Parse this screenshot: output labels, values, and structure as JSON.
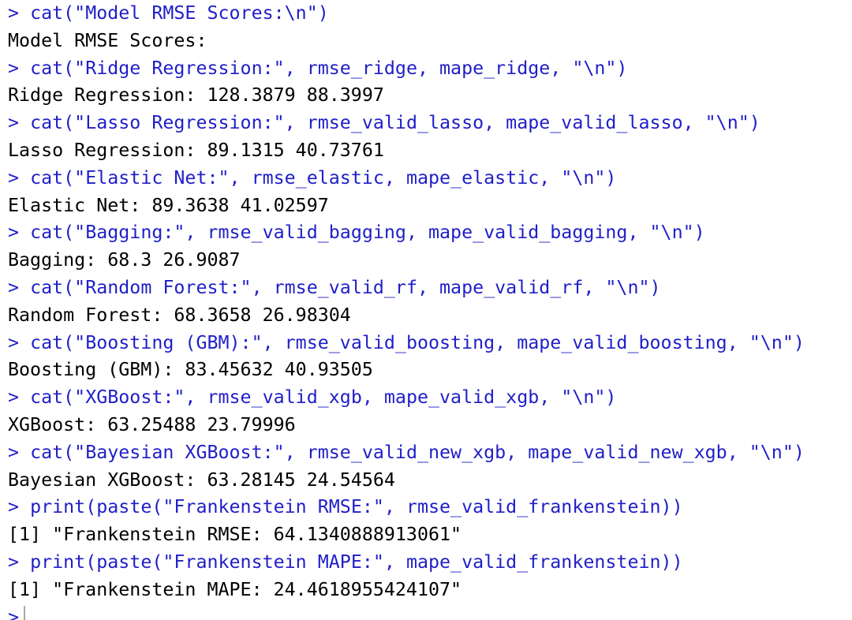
{
  "console": {
    "prompt_symbol": ">",
    "lines": [
      {
        "kind": "cmd",
        "text": "cat(\"Model RMSE Scores:\\n\")"
      },
      {
        "kind": "out",
        "text": "Model RMSE Scores:"
      },
      {
        "kind": "cmd",
        "text": "cat(\"Ridge Regression:\", rmse_ridge, mape_ridge, \"\\n\")"
      },
      {
        "kind": "out",
        "text": "Ridge Regression: 128.3879 88.3997"
      },
      {
        "kind": "cmd",
        "text": "cat(\"Lasso Regression:\", rmse_valid_lasso, mape_valid_lasso, \"\\n\")"
      },
      {
        "kind": "out",
        "text": "Lasso Regression: 89.1315 40.73761"
      },
      {
        "kind": "cmd",
        "text": "cat(\"Elastic Net:\", rmse_elastic, mape_elastic, \"\\n\")"
      },
      {
        "kind": "out",
        "text": "Elastic Net: 89.3638 41.02597"
      },
      {
        "kind": "cmd",
        "text": "cat(\"Bagging:\", rmse_valid_bagging, mape_valid_bagging, \"\\n\")"
      },
      {
        "kind": "out",
        "text": "Bagging: 68.3 26.9087"
      },
      {
        "kind": "cmd",
        "text": "cat(\"Random Forest:\", rmse_valid_rf, mape_valid_rf, \"\\n\")"
      },
      {
        "kind": "out",
        "text": "Random Forest: 68.3658 26.98304"
      },
      {
        "kind": "cmd",
        "text": "cat(\"Boosting (GBM):\", rmse_valid_boosting, mape_valid_boosting, \"\\n\")"
      },
      {
        "kind": "out",
        "text": "Boosting (GBM): 83.45632 40.93505"
      },
      {
        "kind": "cmd",
        "text": "cat(\"XGBoost:\", rmse_valid_xgb, mape_valid_xgb, \"\\n\")"
      },
      {
        "kind": "out",
        "text": "XGBoost: 63.25488 23.79996"
      },
      {
        "kind": "cmd",
        "text": "cat(\"Bayesian XGBoost:\", rmse_valid_new_xgb, mape_valid_new_xgb, \"\\n\")"
      },
      {
        "kind": "out",
        "text": "Bayesian XGBoost: 63.28145 24.54564"
      },
      {
        "kind": "cmd",
        "text": "print(paste(\"Frankenstein RMSE:\", rmse_valid_frankenstein))"
      },
      {
        "kind": "out",
        "text": "[1] \"Frankenstein RMSE: 64.1340888913061\""
      },
      {
        "kind": "cmd",
        "text": "print(paste(\"Frankenstein MAPE:\", mape_valid_frankenstein))"
      },
      {
        "kind": "out",
        "text": "[1] \"Frankenstein MAPE: 24.4618955424107\""
      }
    ],
    "colors": {
      "command": "#1f1fc8",
      "output": "#000000",
      "background": "#ffffff"
    }
  }
}
